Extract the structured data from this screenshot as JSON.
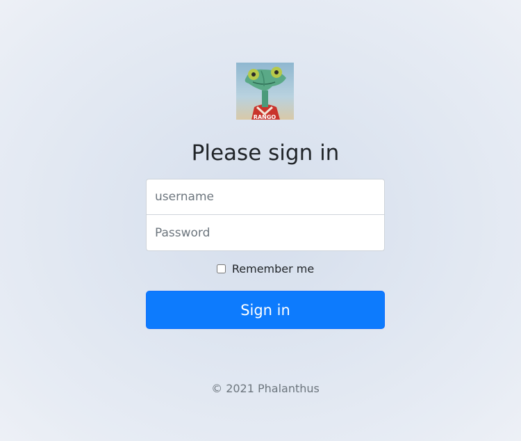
{
  "logo": {
    "icon": "chameleon-avatar-icon",
    "shirt_text": "RANGO"
  },
  "form": {
    "heading": "Please sign in",
    "username_placeholder": "username",
    "password_placeholder": "Password",
    "remember_label": "Remember me",
    "remember_checked": false,
    "submit_label": "Sign in"
  },
  "footer": {
    "copyright": "© 2021 Phalanthus"
  },
  "colors": {
    "primary": "#0d7bfd",
    "background": "#dfe6f1",
    "muted_text": "#6c757d"
  }
}
